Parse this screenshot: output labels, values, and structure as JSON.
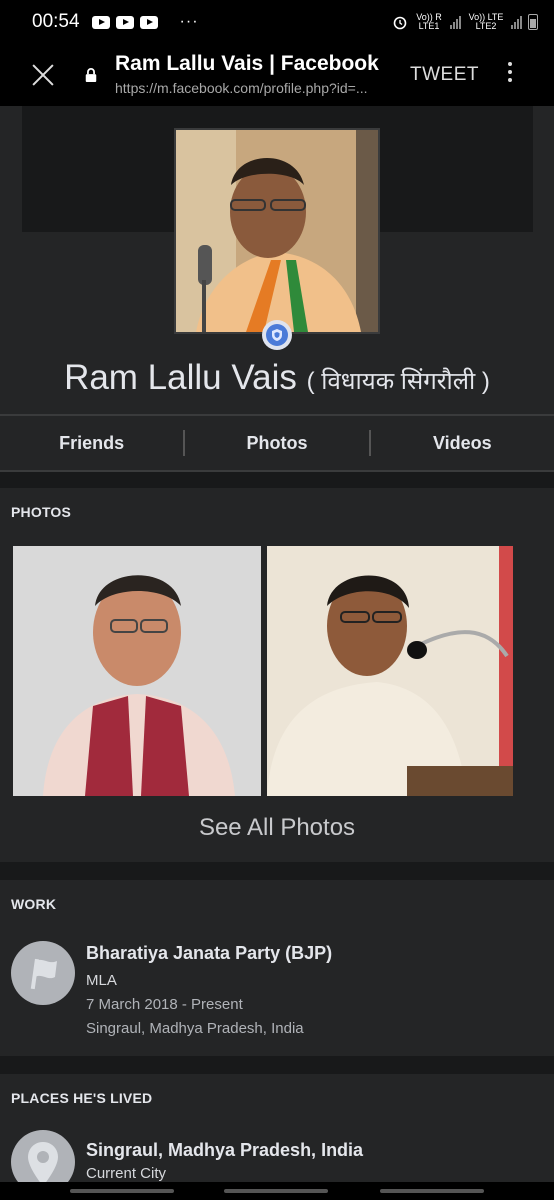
{
  "status_bar": {
    "time": "00:54",
    "dots": "···",
    "sim1": "Vo)) R LTE1",
    "sim2": "Vo)) LTE LTE2"
  },
  "toolbar": {
    "title": "Ram Lallu Vais | Facebook",
    "url": "https://m.facebook.com/profile.php?id=...",
    "tweet_label": "TWEET"
  },
  "profile": {
    "name": "Ram Lallu Vais",
    "subtitle": "( विधायक सिंगरौली )"
  },
  "tabs": [
    "Friends",
    "Photos",
    "Videos"
  ],
  "photos": {
    "title": "PHOTOS",
    "see_all": "See All Photos"
  },
  "work": {
    "title": "WORK",
    "entry": {
      "name": "Bharatiya Janata Party (BJP)",
      "role": "MLA",
      "dates": "7 March 2018 - Present",
      "location": "Singraul, Madhya Pradesh, India"
    }
  },
  "places": {
    "title": "PLACES HE'S LIVED",
    "entry": {
      "name": "Singraul, Madhya Pradesh, India",
      "type": "Current City"
    }
  },
  "colors": {
    "background": "#242526",
    "separator": "#18191a",
    "text": "#e4e6eb",
    "muted": "#b0b3b8",
    "toolbar": "#000000"
  }
}
